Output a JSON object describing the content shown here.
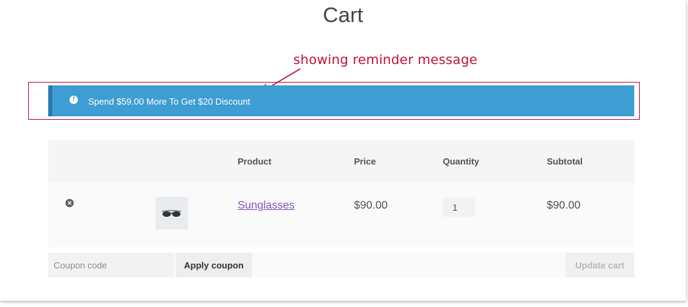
{
  "page": {
    "title": "Cart"
  },
  "annotation": {
    "text": "showing reminder message",
    "color": "#c0113c"
  },
  "notice": {
    "icon": "info-exclamation-icon",
    "text": "Spend $59.00 More To Get $20 Discount",
    "color": "#3e9dd2"
  },
  "cart": {
    "headers": {
      "product": "Product",
      "price": "Price",
      "quantity": "Quantity",
      "subtotal": "Subtotal"
    },
    "items": [
      {
        "remove_icon": "remove-circle-icon",
        "thumbnail_icon": "sunglasses-icon",
        "product": "Sunglasses",
        "price": "$90.00",
        "quantity": "1",
        "subtotal": "$90.00"
      }
    ]
  },
  "actions": {
    "coupon_placeholder": "Coupon code",
    "apply_label": "Apply coupon",
    "update_label": "Update cart"
  },
  "colors": {
    "link": "#7f54b3",
    "accent": "#3e9dd2"
  }
}
